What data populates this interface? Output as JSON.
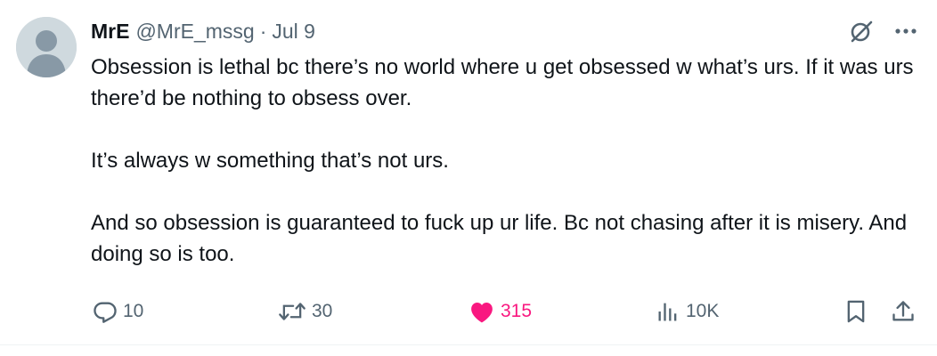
{
  "tweet": {
    "author_name": "MrE",
    "handle": "@MrE_mssg",
    "separator": "·",
    "date": "Jul 9",
    "paragraphs": [
      "Obsession is lethal bc there’s no world where u get obsessed w what’s urs. If it was urs there’d be nothing to obsess over.",
      "It’s always w something that’s not urs.",
      "And so obsession is guaranteed to fuck up ur life. Bc not chasing after it is misery. And doing so is too."
    ]
  },
  "actions": {
    "replies": "10",
    "reposts": "30",
    "likes": "315",
    "views": "10K"
  },
  "colors": {
    "text": "#0f1419",
    "secondary": "#536471",
    "like": "#f91880",
    "avatar_bg": "#cfd9de",
    "avatar_fg": "#8899a6"
  },
  "icons": [
    "grok-icon",
    "more-icon",
    "reply-icon",
    "repost-icon",
    "like-icon",
    "views-icon",
    "bookmark-icon",
    "share-icon"
  ]
}
